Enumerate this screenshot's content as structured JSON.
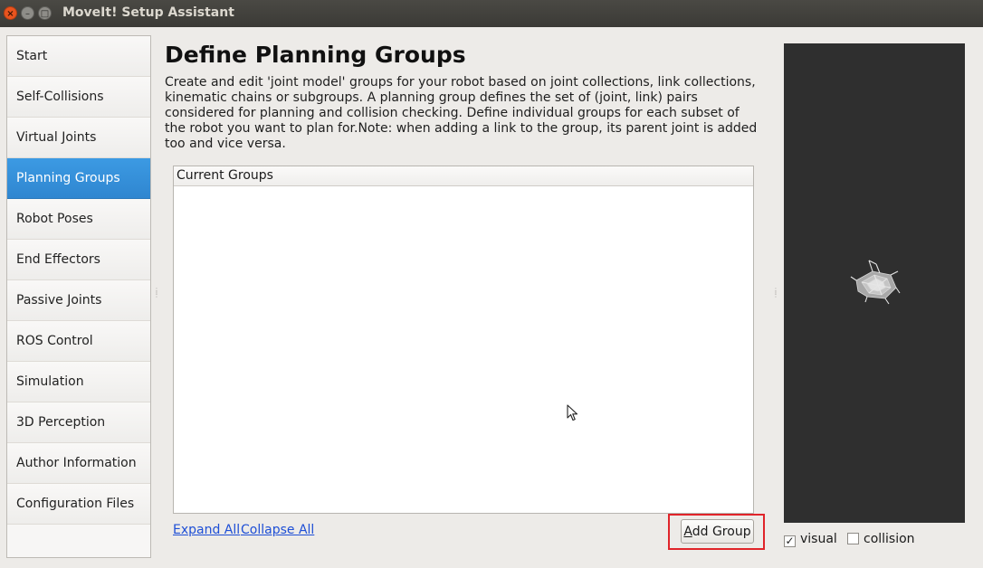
{
  "window": {
    "title": "MoveIt! Setup Assistant",
    "close_glyph": "×",
    "min_glyph": "–",
    "max_glyph": "□"
  },
  "sidebar": {
    "active_index": 3,
    "items": [
      {
        "label": "Start"
      },
      {
        "label": "Self-Collisions"
      },
      {
        "label": "Virtual Joints"
      },
      {
        "label": "Planning Groups"
      },
      {
        "label": "Robot Poses"
      },
      {
        "label": "End Effectors"
      },
      {
        "label": "Passive Joints"
      },
      {
        "label": "ROS Control"
      },
      {
        "label": "Simulation"
      },
      {
        "label": "3D Perception"
      },
      {
        "label": "Author Information"
      },
      {
        "label": "Configuration Files"
      }
    ]
  },
  "main": {
    "title": "Define Planning Groups",
    "description": "Create and edit 'joint model' groups for your robot based on joint collections, link collections, kinematic chains or subgroups. A planning group defines the set of (joint, link) pairs considered for planning and collision checking. Define individual groups for each subset of the robot you want to plan for.Note: when adding a link to the group, its parent joint is added too and vice versa.",
    "tree_header": "Current Groups",
    "expand_all": "Expand All",
    "collapse_all": "Collapse All",
    "add_group_prefix": "A",
    "add_group_rest": "dd Group"
  },
  "viewer": {
    "background": "#2f2f2f",
    "visual_label": "visual",
    "visual_checked": true,
    "visual_mark": "✓",
    "collision_label": "collision",
    "collision_checked": false,
    "collision_mark": ""
  },
  "colors": {
    "accent": "#3591db",
    "highlight": "#e0242a",
    "link": "#1e4fd6"
  }
}
